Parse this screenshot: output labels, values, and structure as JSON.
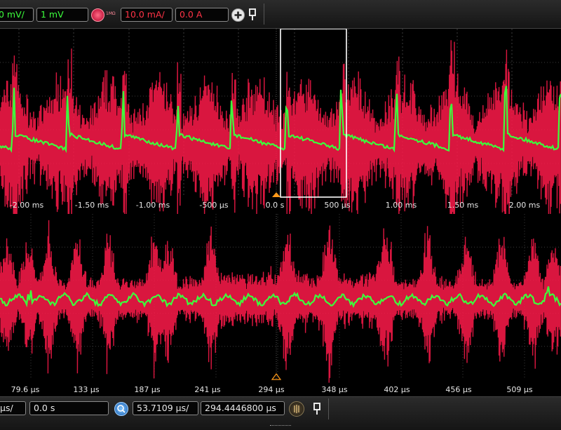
{
  "top_bar": {
    "ch1_scale": "0 mV/",
    "ch1_offset": "1 mV",
    "ch2_badge": "1MΩ",
    "ch2_scale": "10.0 mA/",
    "ch2_offset": "0.0 A",
    "add_icon": "plus-icon",
    "pin_icon": "pin-icon"
  },
  "upper_plot": {
    "time_labels": [
      "-2.00 ms",
      "-1.50 ms",
      "-1.00 ms",
      "-500 µs",
      "0.0 s",
      "500 µs",
      "1.00 ms",
      "1.50 ms",
      "2.00 ms"
    ],
    "trace_colors": {
      "voltage": "#3cff3c",
      "current": "#ff1a4a"
    },
    "zoom_box_color": "#ffffff",
    "trigger_marker_color": "#ff9a1a"
  },
  "lower_plot": {
    "time_labels": [
      "79.6 µs",
      "133 µs",
      "187 µs",
      "241 µs",
      "294 µs",
      "348 µs",
      "402 µs",
      "456 µs",
      "509 µs"
    ],
    "trigger_marker_color": "#ff9a1a"
  },
  "bottom_bar": {
    "timebase_scale": "µs/",
    "trigger_delay": "0.0 s",
    "zoom_icon": "zoom-icon",
    "zoom_scale": "53.7109 µs/",
    "zoom_position": "294.4446800 µs",
    "run_icon": "run-control-icon",
    "pin_icon": "pin-icon"
  },
  "colors": {
    "background": "#000000",
    "grid": "#3a3a3a",
    "voltage": "#3cff3c",
    "current": "#ff1a4a"
  }
}
